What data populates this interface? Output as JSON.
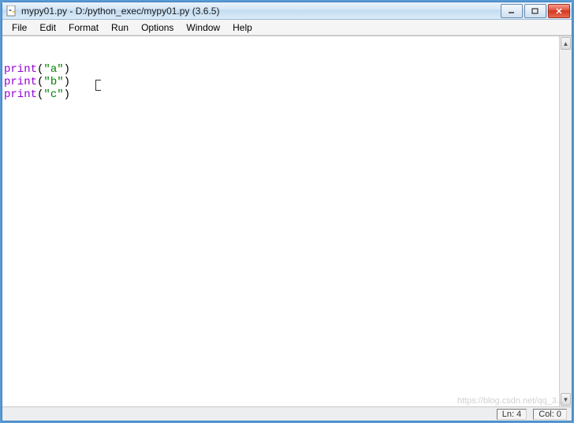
{
  "window": {
    "title": "mypy01.py - D:/python_exec/mypy01.py (3.6.5)"
  },
  "menu": {
    "file": "File",
    "edit": "Edit",
    "format": "Format",
    "run": "Run",
    "options": "Options",
    "window": "Window",
    "help": "Help"
  },
  "code": {
    "lines": [
      {
        "fn": "print",
        "arg": "\"a\""
      },
      {
        "fn": "print",
        "arg": "\"b\""
      },
      {
        "fn": "print",
        "arg": "\"c\""
      }
    ]
  },
  "status": {
    "line": "Ln: 4",
    "col": "Col: 0"
  },
  "watermark": "https://blog.csdn.net/qq_3..."
}
